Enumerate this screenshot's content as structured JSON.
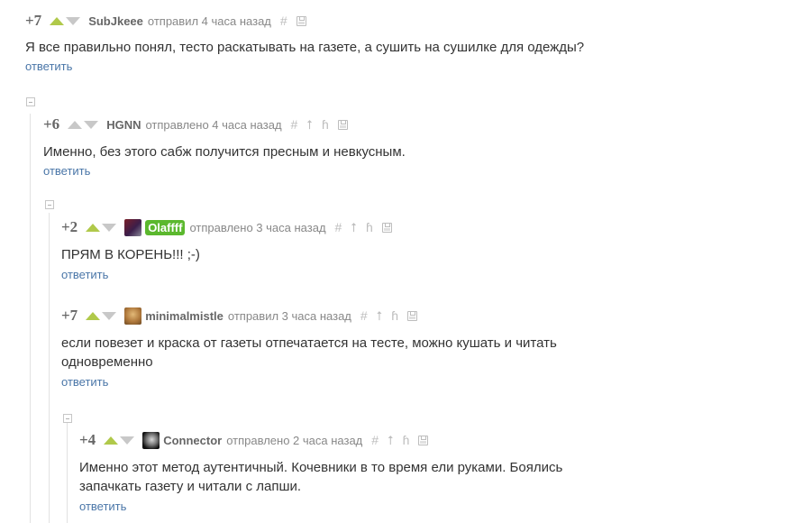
{
  "comments": [
    {
      "rating": "+7",
      "username": "SubJkeee",
      "meta": "отправил 4 часа назад",
      "text": "Я все правильно понял, тесто раскатывать на газете, а сушить на сушилке для одежды?",
      "reply": "ответить"
    },
    {
      "rating": "+6",
      "username": "HGNN",
      "meta": "отправлено 4 часа назад",
      "text": "Именно, без этого сабж получится пресным и невкусным.",
      "reply": "ответить"
    },
    {
      "rating": "+2",
      "username": "Olaffff",
      "meta": "отправлено 3 часа назад",
      "text": "ПРЯМ В КОРЕНЬ!!! ;-)",
      "reply": "ответить"
    },
    {
      "rating": "+7",
      "username": "minimalmistle",
      "meta": "отправил 3 часа назад",
      "text": "если повезет и краска от газеты отпечатается на тесте, можно кушать и читать одновременно",
      "reply": "ответить"
    },
    {
      "rating": "+4",
      "username": "Connector",
      "meta": "отправлено 2 часа назад",
      "text": "Именно этот метод аутентичный. Кочевники в то время ели руками. Боялись запачкать газету и читали с лапши.",
      "reply": "ответить"
    }
  ],
  "icons": {
    "hash": "#",
    "parent": "⭡",
    "branch": "ɦ"
  },
  "colors": {
    "vote_up": "#b0c94a",
    "vote_down": "#c8c8c8",
    "link": "#4a76a8",
    "username_highlight": "#5bb82e"
  }
}
